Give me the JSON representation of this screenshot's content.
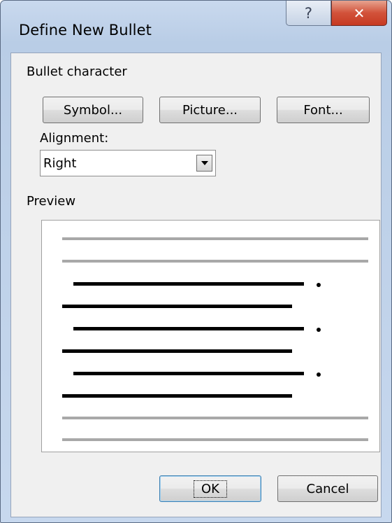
{
  "window": {
    "title": "Define New Bullet",
    "help_glyph": "?",
    "close_glyph": "✕"
  },
  "bullet_character": {
    "group_label": "Bullet character",
    "symbol_button": "Symbol...",
    "picture_button": "Picture...",
    "font_button": "Font..."
  },
  "alignment": {
    "label": "Alignment:",
    "selected": "Right"
  },
  "preview": {
    "label": "Preview"
  },
  "footer": {
    "ok": "OK",
    "cancel": "Cancel"
  }
}
